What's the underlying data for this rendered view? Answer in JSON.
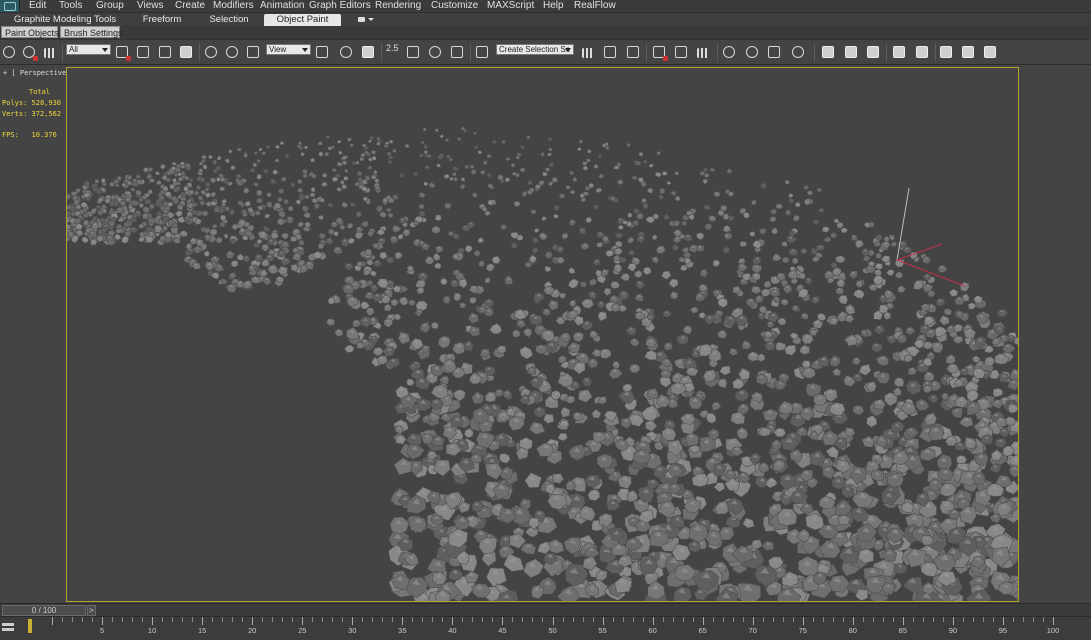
{
  "menubar": {
    "items": [
      "Edit",
      "Tools",
      "Group",
      "Views",
      "Create",
      "Modifiers",
      "Animation",
      "Graph Editors",
      "Rendering",
      "Customize",
      "MAXScript",
      "Help",
      "RealFlow"
    ]
  },
  "ribbon": {
    "tabs": [
      {
        "label": "Graphite Modeling Tools",
        "active": false
      },
      {
        "label": "Freeform",
        "active": false
      },
      {
        "label": "Selection",
        "active": false
      },
      {
        "label": "Object Paint",
        "active": true
      }
    ],
    "panels": [
      "Paint Objects",
      "Brush Settings"
    ]
  },
  "toolbar": {
    "selection_filter": "All",
    "reference_coord": "View",
    "snap_value": "2.5",
    "named_selection_placeholder": "Create Selection Se"
  },
  "viewport": {
    "label": "+ [ Perspective ] [ Smooth + Highlights ]",
    "accent_color": "#b5a32f",
    "stats": {
      "title": "Total",
      "polys_label": "Polys:",
      "polys_value": "528,930",
      "verts_label": "Verts:",
      "verts_value": "372,562",
      "fps_label": "FPS:",
      "fps_value": "10.376"
    }
  },
  "timeline": {
    "slider_label": "0 / 100",
    "next_button": ">",
    "tick_labels": [
      "0",
      "5",
      "10",
      "15",
      "20",
      "25",
      "30",
      "35",
      "40",
      "45",
      "50",
      "55",
      "60",
      "65",
      "70",
      "75",
      "80",
      "85",
      "90",
      "95",
      "100"
    ]
  }
}
